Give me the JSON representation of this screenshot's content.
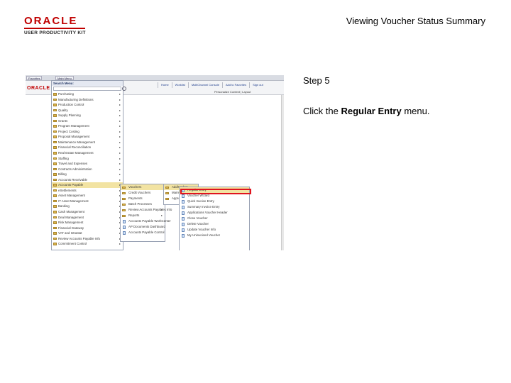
{
  "logo": {
    "word": "ORACLE",
    "sub": "USER PRODUCTIVITY KIT"
  },
  "doc_title": "Viewing Voucher Status Summary",
  "step": "Step 5",
  "instruction": {
    "before": "Click the ",
    "bold": "Regular Entry",
    "after": " menu."
  },
  "app": {
    "tabs": [
      "Favorites",
      "Main Menu"
    ],
    "mini_logo": "ORACLE",
    "top_links": [
      "Home",
      "Worklist",
      "MultiChannel Console",
      "Add to Favorites",
      "Sign out"
    ],
    "personalize": "Personalize Content | Layout",
    "menu1": {
      "title": "Search Menu:",
      "items": [
        {
          "label": "Purchasing",
          "arrow": true
        },
        {
          "label": "Manufacturing Definitions",
          "arrow": true
        },
        {
          "label": "Production Control",
          "arrow": true
        },
        {
          "label": "Quality",
          "arrow": true
        },
        {
          "label": "Supply Planning",
          "arrow": true
        },
        {
          "label": "Grants",
          "arrow": true
        },
        {
          "label": "Program Management",
          "arrow": true
        },
        {
          "label": "Project Costing",
          "arrow": true
        },
        {
          "label": "Proposal Management",
          "arrow": true
        },
        {
          "label": "Maintenance Management",
          "arrow": true
        },
        {
          "label": "Financial Reconciliation",
          "arrow": true
        },
        {
          "label": "Real Estate Management",
          "arrow": true
        },
        {
          "label": "Staffing",
          "arrow": true
        },
        {
          "label": "Travel and Expenses",
          "arrow": true
        },
        {
          "label": "Contracts Administration",
          "arrow": true
        },
        {
          "label": "Billing",
          "arrow": true
        },
        {
          "label": "Accounts Receivable",
          "arrow": true
        },
        {
          "label": "Accounts Payable",
          "arrow": true,
          "highlight": true
        },
        {
          "label": "eSettlements",
          "arrow": true
        },
        {
          "label": "Asset Management",
          "arrow": true
        },
        {
          "label": "IT Asset Management",
          "arrow": true
        },
        {
          "label": "Banking",
          "arrow": true
        },
        {
          "label": "Cash Management",
          "arrow": true
        },
        {
          "label": "Deal Management",
          "arrow": true
        },
        {
          "label": "Risk Management",
          "arrow": true
        },
        {
          "label": "Financial Gateway",
          "arrow": true
        },
        {
          "label": "VAT and Intrastat",
          "arrow": true
        },
        {
          "label": "Review Accounts Payable Info",
          "arrow": true
        },
        {
          "label": "Commitment Control",
          "arrow": true
        }
      ]
    },
    "menu2": [
      {
        "label": "Vouchers",
        "folder": true,
        "highlight": true
      },
      {
        "label": "Credit Vouchers",
        "folder": true
      },
      {
        "label": "Payments",
        "folder": true
      },
      {
        "label": "Batch Processes",
        "folder": true
      },
      {
        "label": "Review Accounts Payables Info",
        "folder": true,
        "arrow": true
      },
      {
        "label": "Reports",
        "folder": true,
        "arrow": true
      },
      {
        "label": "Accounts Payable WorkCenter",
        "folder": false
      },
      {
        "label": "AP Documents Dashboard",
        "folder": false
      },
      {
        "label": "Accounts Payable Control",
        "folder": false
      }
    ],
    "menu3": [
      {
        "label": "Add/Update",
        "highlight": true
      },
      {
        "label": "Maintain"
      },
      {
        "label": "Approve"
      }
    ],
    "menu4": [
      {
        "label": "Regular Entry",
        "highlight": true
      },
      {
        "label": "Voucher Wizard"
      },
      {
        "label": "Quick Invoice Entry"
      },
      {
        "label": "Summary Invoice Entry"
      },
      {
        "label": "Applications Voucher Header"
      },
      {
        "label": "Close Voucher"
      },
      {
        "label": "Delete Voucher"
      },
      {
        "label": "Update Voucher Info"
      },
      {
        "label": "My Uninvoiced Voucher"
      }
    ]
  }
}
